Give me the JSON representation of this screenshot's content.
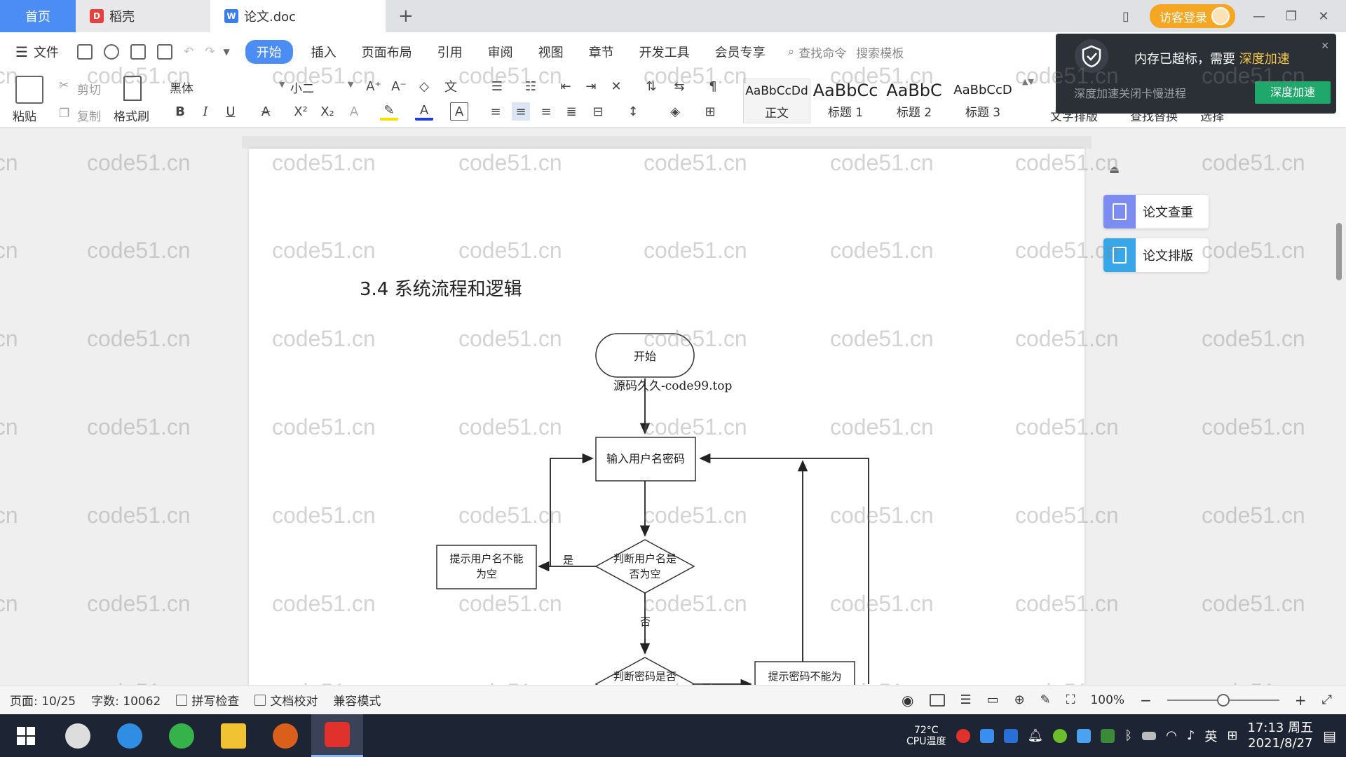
{
  "tabs": {
    "home": "首页",
    "daoke": "稻壳",
    "doc": "论文.doc",
    "add": "+"
  },
  "titlebar": {
    "login": "访客登录"
  },
  "menu": {
    "file": "文件",
    "items": [
      "开始",
      "插入",
      "页面布局",
      "引用",
      "审阅",
      "视图",
      "章节",
      "开发工具",
      "会员专享"
    ],
    "search_cmd": "查找命令",
    "search_tpl": "搜索模板"
  },
  "ribbon": {
    "paste": "粘贴",
    "cut": "剪切",
    "copy": "复制",
    "format_painter": "格式刷",
    "font": "黑体",
    "size": "小二",
    "styles": [
      {
        "preview": "AaBbCcDd",
        "name": "正文"
      },
      {
        "preview": "AaBbCc",
        "name": "标题 1"
      },
      {
        "preview": "AaBbC",
        "name": "标题 2"
      },
      {
        "preview": "AaBbCcD",
        "name": "标题 3"
      }
    ],
    "text_layout": "文字排版",
    "find_replace": "查找替换",
    "select": "选择"
  },
  "notification": {
    "text": "内存已超标，需要",
    "highlight": "深度加速",
    "subtext": "深度加速关闭卡慢进程",
    "button": "深度加速"
  },
  "document": {
    "heading": "3.4 系统流程和逻辑",
    "watermark_text": "code51.cn",
    "flow": {
      "start": "开始",
      "source": "源码久久-code99.top",
      "input": "输入用户名密码",
      "check_user": [
        "判断用户名是",
        "否为空"
      ],
      "warn_user": [
        "提示用户名不能",
        "为空"
      ],
      "yes": "是",
      "no": "否",
      "check_pwd": "判断密码是否",
      "warn_pwd": "提示密码不能为"
    }
  },
  "side_panel": {
    "check": "论文查重",
    "layout": "论文排版"
  },
  "status": {
    "page": "页面: 10/25",
    "words": "字数: 10062",
    "spell": "拼写检查",
    "proof": "文档校对",
    "compat": "兼容模式",
    "zoom": "100%",
    "zoom_level": 0.5
  },
  "taskbar": {
    "temp": "72°C",
    "cpu_label": "CPU温度",
    "ime": "英",
    "time": "17:13 周五",
    "date": "2021/8/27"
  },
  "colors": {
    "accent": "#4b8cf5",
    "login": "#f5a623",
    "notify_bg": "#2b2f36",
    "notify_btn": "#1ea86c"
  }
}
